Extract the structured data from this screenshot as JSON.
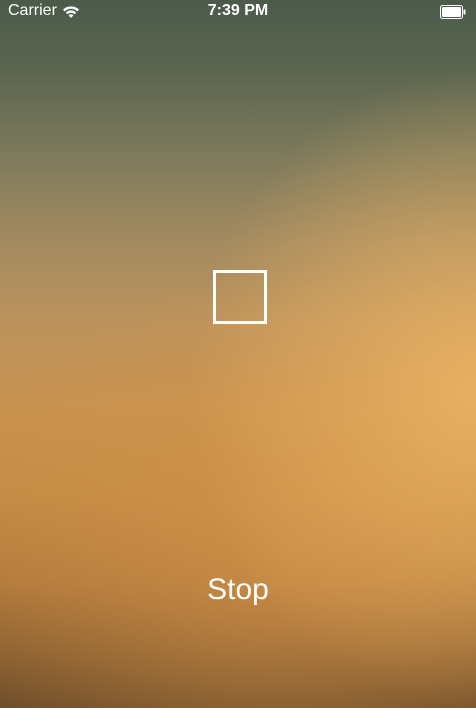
{
  "status_bar": {
    "carrier": "Carrier",
    "time": "7:39 PM",
    "wifi_icon": "wifi-icon",
    "battery_icon": "battery-full-icon",
    "battery_level": 1.0
  },
  "main": {
    "focus_indicator_icon": "focus-square-icon",
    "stop_label": "Stop"
  },
  "colors": {
    "text": "#ffffff",
    "background_top": "#4b5a4a",
    "background_mid": "#c8924f",
    "background_bottom": "#6f4e2a"
  }
}
